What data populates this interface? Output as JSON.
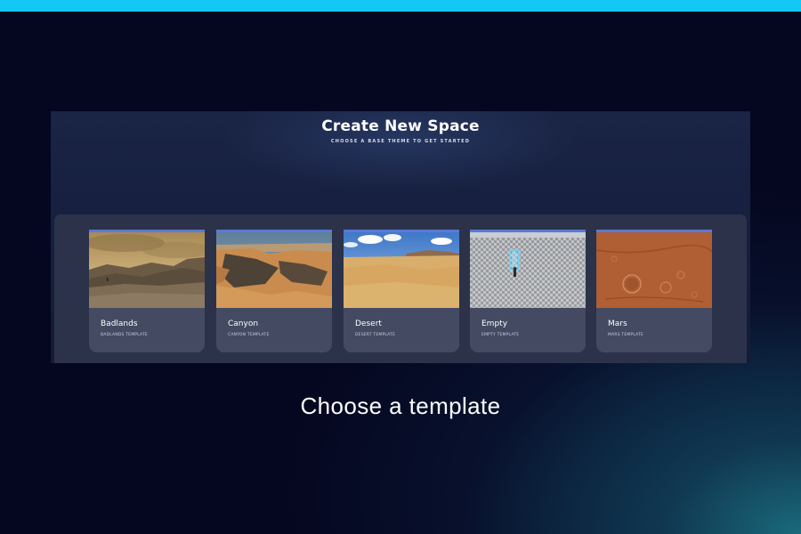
{
  "dialog": {
    "title": "Create New Space",
    "subtitle": "CHOOSE A BASE THEME TO GET STARTED"
  },
  "templates": [
    {
      "name": "Badlands",
      "description": "BADLANDS TEMPLATE",
      "thumbnail_icon": "badlands-landscape"
    },
    {
      "name": "Canyon",
      "description": "CANYON TEMPLATE",
      "thumbnail_icon": "canyon-landscape"
    },
    {
      "name": "Desert",
      "description": "DESERT TEMPLATE",
      "thumbnail_icon": "desert-landscape"
    },
    {
      "name": "Empty",
      "description": "EMPTY TEMPLATE",
      "thumbnail_icon": "empty-grid-scene"
    },
    {
      "name": "Mars",
      "description": "MARS TEMPLATE",
      "thumbnail_icon": "mars-surface"
    }
  ],
  "caption": "Choose a template",
  "colors": {
    "accent_bar": "#14c8f5",
    "card_stripe": "#5b78d6",
    "card_bg": "#434a62",
    "background": "#05061f"
  }
}
